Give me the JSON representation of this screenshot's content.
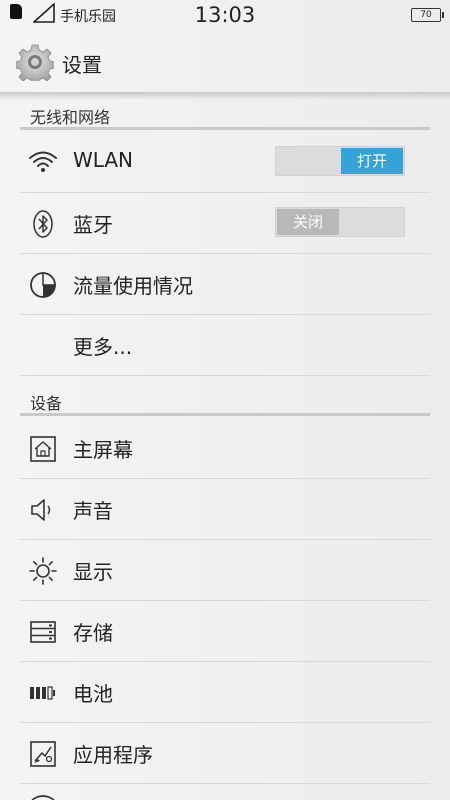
{
  "status_bar": {
    "carrier": "手机乐园",
    "time": "13:03",
    "battery": "70"
  },
  "header": {
    "title": "设置",
    "icon": "gear-icon"
  },
  "sections": {
    "wireless": {
      "title": "无线和网络",
      "items": {
        "wlan": {
          "label": "WLAN",
          "icon": "wifi-icon",
          "toggle": "打开",
          "state": "on"
        },
        "bluetooth": {
          "label": "蓝牙",
          "icon": "bluetooth-icon",
          "toggle": "关闭",
          "state": "off"
        },
        "data_usage": {
          "label": "流量使用情况",
          "icon": "pie-chart-icon"
        },
        "more": {
          "label": "更多..."
        }
      }
    },
    "device": {
      "title": "设备",
      "items": {
        "home_screen": {
          "label": "主屏幕",
          "icon": "home-icon"
        },
        "sound": {
          "label": "声音",
          "icon": "speaker-icon"
        },
        "display": {
          "label": "显示",
          "icon": "sun-icon"
        },
        "storage": {
          "label": "存储",
          "icon": "storage-icon"
        },
        "battery": {
          "label": "电池",
          "icon": "battery-icon"
        },
        "apps": {
          "label": "应用程序",
          "icon": "apps-icon"
        }
      }
    }
  },
  "colors": {
    "accent": "#33a3d8",
    "background": "#f0f0f0",
    "divider": "#c9c9c9"
  }
}
